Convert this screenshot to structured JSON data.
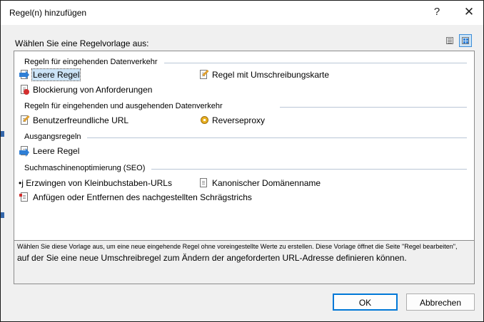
{
  "window": {
    "title": "Regel(n) hinzufügen",
    "help_glyph": "?",
    "close_glyph": "✕"
  },
  "prompt": "Wählen Sie eine Regelvorlage aus:",
  "view_toggle": {
    "left_icon": "list-view-icon",
    "right_icon": "large-icons-view-icon",
    "selected": "large-icons-view-icon"
  },
  "groups": [
    {
      "title": "Regeln für eingehenden Datenverkehr",
      "items": [
        {
          "label": "Leere Regel",
          "icon": "inbound-rule-icon",
          "selected": true
        },
        {
          "label": "Regel mit Umschreibungskarte",
          "icon": "rewrite-map-icon"
        },
        {
          "label": "Blockierung von Anforderungen",
          "icon": "block-request-icon"
        }
      ]
    },
    {
      "title": "Regeln für eingehenden und ausgehenden Datenverkehr",
      "items": [
        {
          "label": "Benutzerfreundliche URL",
          "icon": "friendly-url-icon"
        },
        {
          "label": "Reverseproxy",
          "icon": "reverse-proxy-icon"
        }
      ]
    },
    {
      "title": "Ausgangsregeln",
      "items": [
        {
          "label": "Leere Regel",
          "icon": "outbound-rule-icon"
        }
      ]
    },
    {
      "title": "Suchmaschinenoptimierung (SEO)",
      "items": [
        {
          "label": "•j Erzwingen von Kleinbuchstaben-URLs",
          "icon": ""
        },
        {
          "label": "Kanonischer Domänenname",
          "icon": "canonical-domain-icon"
        },
        {
          "label": "Anfügen oder Entfernen des nachgestellten Schrägstrichs",
          "icon": "trailing-slash-icon"
        }
      ]
    }
  ],
  "description": {
    "line1": "Wählen Sie diese Vorlage aus, um eine neue eingehende Regel ohne voreingestellte Werte zu erstellen. Diese Vorlage öffnet die Seite \"Regel bearbeiten\",",
    "line2": "auf der Sie eine neue Umschreibregel zum Ändern der angeforderten URL-Adresse definieren können."
  },
  "buttons": {
    "ok": "OK",
    "cancel": "Abbrechen"
  },
  "colors": {
    "selection": "#cce4f7",
    "accent": "#0078d7",
    "group_line": "#b9c6d6"
  }
}
